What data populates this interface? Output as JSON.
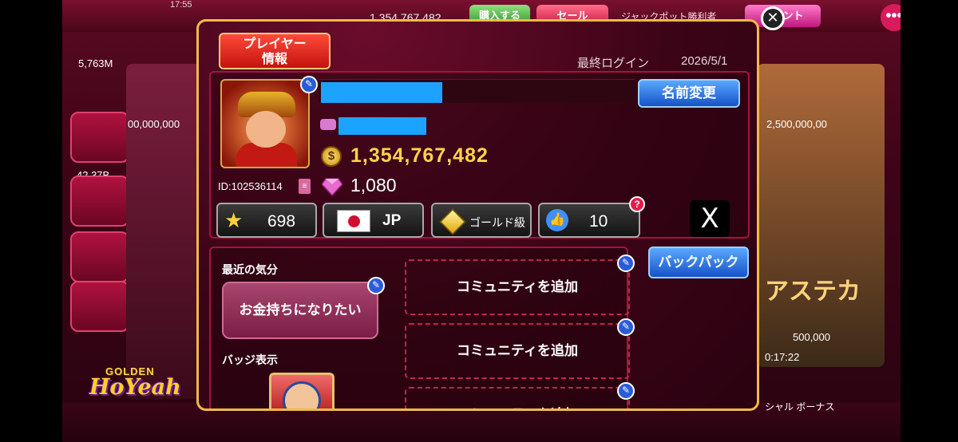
{
  "status_bar": {
    "time": "17:55"
  },
  "background": {
    "top_coins": "1,354,767,482",
    "buy_button": "購入する",
    "sale_button": "セール",
    "jackpot_label": "ジャックポット勝利者",
    "event_button": "イベント",
    "left_balance": "5,763M",
    "left_jackpot": "00,000,000",
    "left_small": "42.37B",
    "right_jackpot": "2,500,000,00",
    "right_game_title": "アステカ",
    "right_max_value": "500,000",
    "right_timer": "0:17:22",
    "bottom_right_label": "シャル ボーナス"
  },
  "logo": {
    "top": "GOLDEN",
    "main": "HoYeah"
  },
  "profile": {
    "tab_label": "プレイヤー情報",
    "last_login_label": "最終ログイン",
    "last_login_value": "2026/5/1",
    "rename_button": "名前変更",
    "player_id": "ID:102536114",
    "coins": "1,354,767,482",
    "gems": "1,080",
    "level": "698",
    "country_code": "JP",
    "rank": "ゴールド級",
    "likes": "10",
    "help_badge": "?",
    "x_button": "X",
    "mood_label": "最近の気分",
    "mood_value": "お金持ちになりたい",
    "badge_label": "バッジ表示",
    "community_slots": [
      "コミュニティを追加",
      "コミュニティを追加",
      "コミュニティを追加"
    ],
    "backpack_button": "バックパック"
  },
  "colors": {
    "panel_border": "#f1b94a",
    "coin_text": "#ffd34a",
    "action_blue": "#1552c8",
    "accent_red": "#c4120f",
    "redaction": "#1ca3ff"
  },
  "icons": [
    "close-icon",
    "edit-icon",
    "coin-icon",
    "gem-icon",
    "star-icon",
    "japan-flag-icon",
    "gold-gem-icon",
    "thumbs-up-icon",
    "x-logo-icon",
    "copy-icon"
  ]
}
